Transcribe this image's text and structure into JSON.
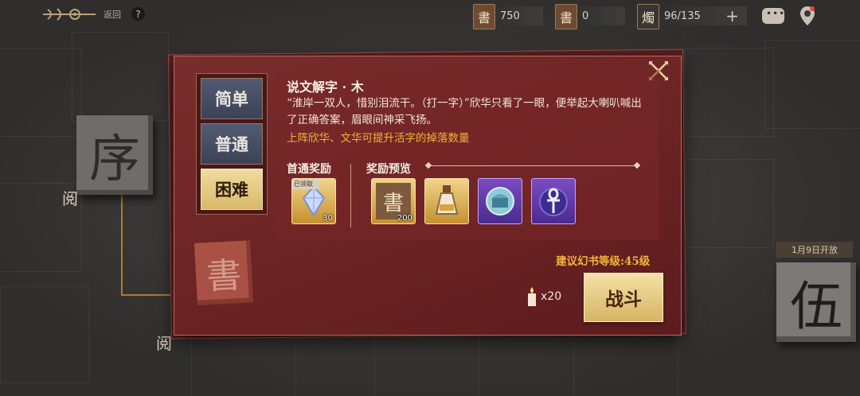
{
  "topbar": {
    "back_label": "返回",
    "help_symbol": "?",
    "resources": [
      {
        "icon_char": "書",
        "value": "750"
      },
      {
        "icon_char": "書",
        "value": "0"
      },
      {
        "icon_char": "燭",
        "value": "96/135"
      }
    ],
    "plus_symbol": "+"
  },
  "background": {
    "tile_left_char": "序",
    "small_read_label": "阅",
    "open_badge": "1月9日开放",
    "tile_right_char": "伍",
    "stamp_char": "書"
  },
  "tabs": [
    {
      "label": "简单",
      "active": false
    },
    {
      "label": "普通",
      "active": false
    },
    {
      "label": "困难",
      "active": true
    }
  ],
  "stage": {
    "title": "说文解字 · 木",
    "description": "“淮岸一双人，惜别泪流干。（打一字）”欣华只看了一眼，便举起大喇叭喊出了正确答案，眉眼间神采飞扬。",
    "hint": "上阵欣华、文华可提升活字的掉落数量"
  },
  "first_reward": {
    "label": "首通奖励",
    "item": {
      "claimed_label": "已领取",
      "count": "30",
      "icon": "crystal-icon"
    }
  },
  "reward_preview": {
    "label": "奖励预览",
    "items": [
      {
        "icon": "book-block-icon",
        "char": "書",
        "count": "200",
        "rarity": "gold"
      },
      {
        "icon": "potion-icon",
        "count": "",
        "rarity": "gold"
      },
      {
        "icon": "blue-chest-icon",
        "count": "",
        "rarity": "purple"
      },
      {
        "icon": "ankh-icon",
        "count": "",
        "rarity": "purple"
      }
    ]
  },
  "recommend_level": "建议幻书等级:45级",
  "cost": {
    "icon": "candle-icon",
    "amount": "x20"
  },
  "fight_label": "战斗",
  "colors": {
    "accent": "#f2b53a",
    "modal": "#6b2324",
    "button": "#e6c97f"
  }
}
